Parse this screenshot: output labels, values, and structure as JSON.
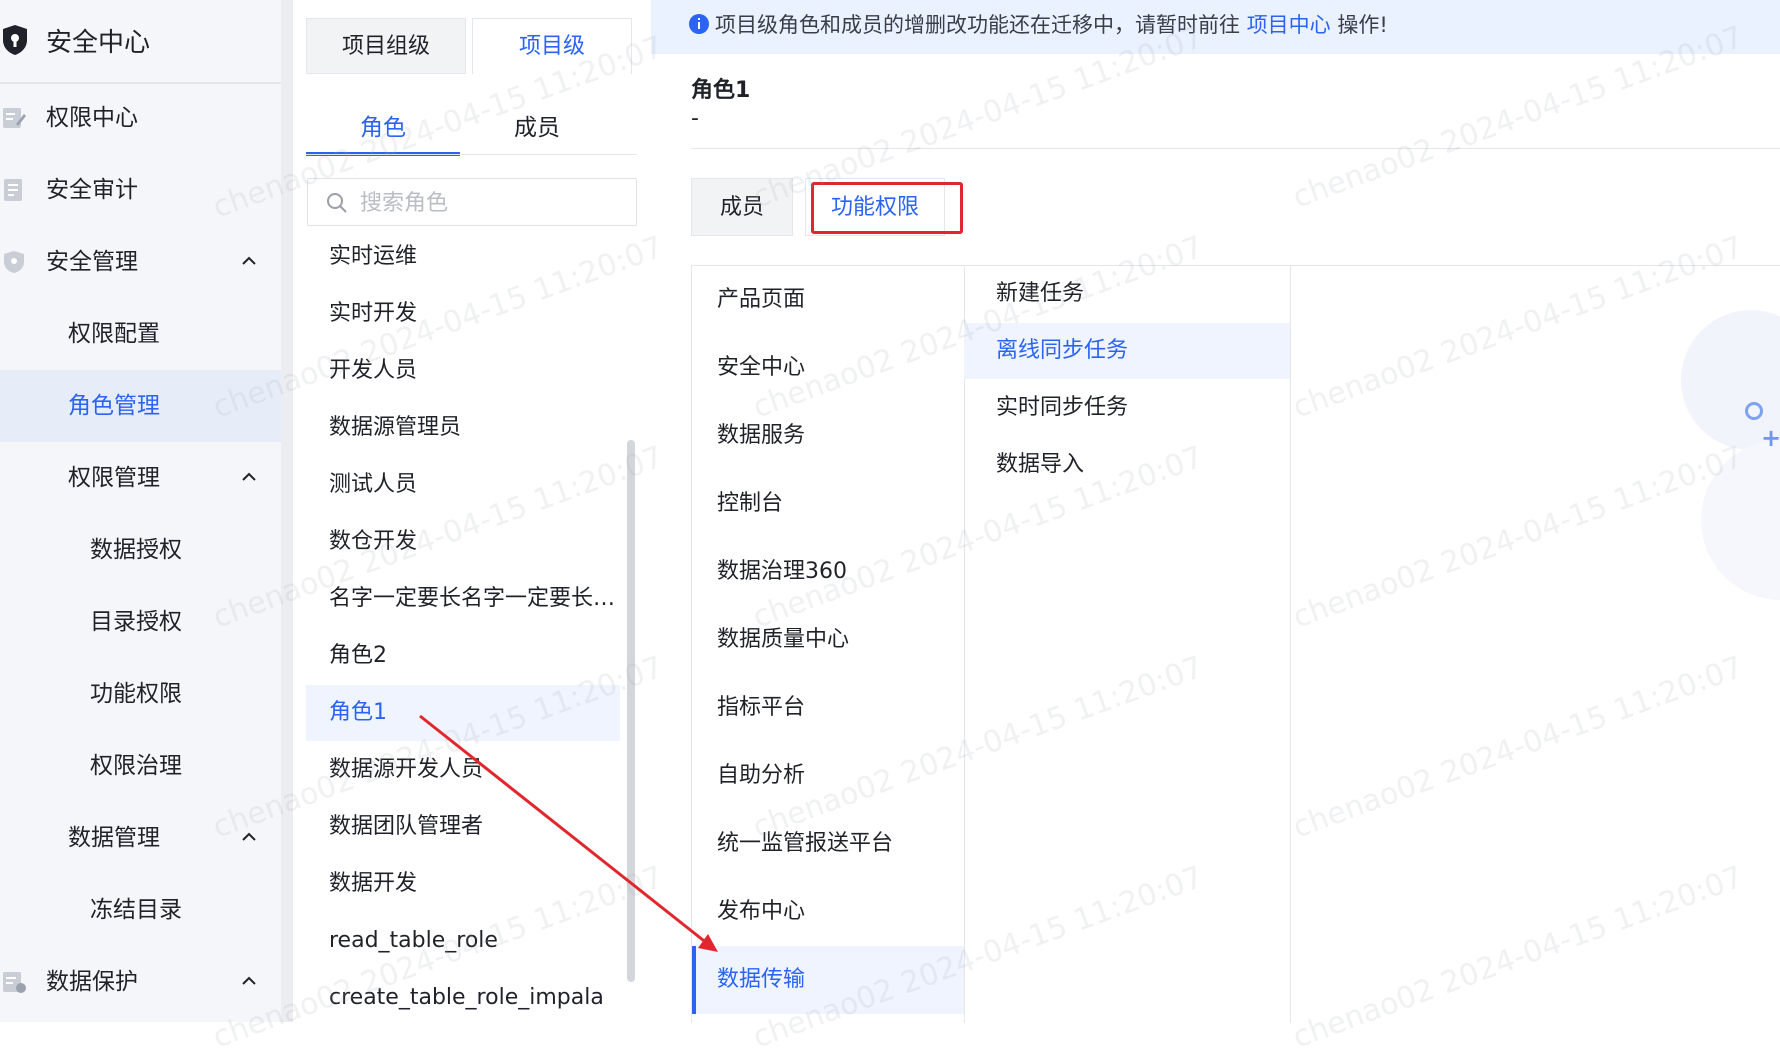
{
  "sidebar": {
    "header_title": "安全中心",
    "items": [
      {
        "label": "权限中心",
        "icon": "permission-icon"
      },
      {
        "label": "安全审计",
        "icon": "audit-icon"
      },
      {
        "label": "安全管理",
        "icon": "shield-icon"
      },
      {
        "label": "权限配置"
      },
      {
        "label": "角色管理"
      },
      {
        "label": "权限管理"
      },
      {
        "label": "数据授权"
      },
      {
        "label": "目录授权"
      },
      {
        "label": "功能权限"
      },
      {
        "label": "权限治理"
      },
      {
        "label": "数据管理"
      },
      {
        "label": "冻结目录"
      },
      {
        "label": "数据保护",
        "icon": "data-protect-icon"
      }
    ]
  },
  "mid": {
    "level_tabs": [
      "项目组级",
      "项目级"
    ],
    "sub_tabs": [
      "角色",
      "成员"
    ],
    "search_placeholder": "搜索角色",
    "roles": [
      "实时运维",
      "实时开发",
      "开发人员",
      "数据源管理员",
      "测试人员",
      "数仓开发",
      "名字一定要长名字一定要长名字一定要长",
      "角色2",
      "角色1",
      "数据源开发人员",
      "数据团队管理者",
      "数据开发",
      "read_table_role",
      "create_table_role_impala"
    ],
    "selected_role": "角色1"
  },
  "right": {
    "notice": {
      "prefix": "项目级角色和成员的增删改功能还在迁移中，请暂时前往",
      "link": "项目中心",
      "suffix": "操作!"
    },
    "role_title": "角色1",
    "role_desc": "-",
    "tabs": [
      "成员",
      "功能权限"
    ],
    "categories": [
      "产品页面",
      "安全中心",
      "数据服务",
      "控制台",
      "数据治理360",
      "数据质量中心",
      "指标平台",
      "自助分析",
      "统一监管报送平台",
      "发布中心",
      "数据传输"
    ],
    "selected_category": "数据传输",
    "sub_items": [
      "新建任务",
      "离线同步任务",
      "实时同步任务",
      "数据导入"
    ],
    "selected_sub": "离线同步任务"
  },
  "watermark": "chenao02 2024-04-15 11:20:07",
  "colors": {
    "accent": "#2a63f5",
    "highlight_box": "#e1262d",
    "selected_bg": "#f0f4ff",
    "notice_bg": "#eaf1ff"
  }
}
